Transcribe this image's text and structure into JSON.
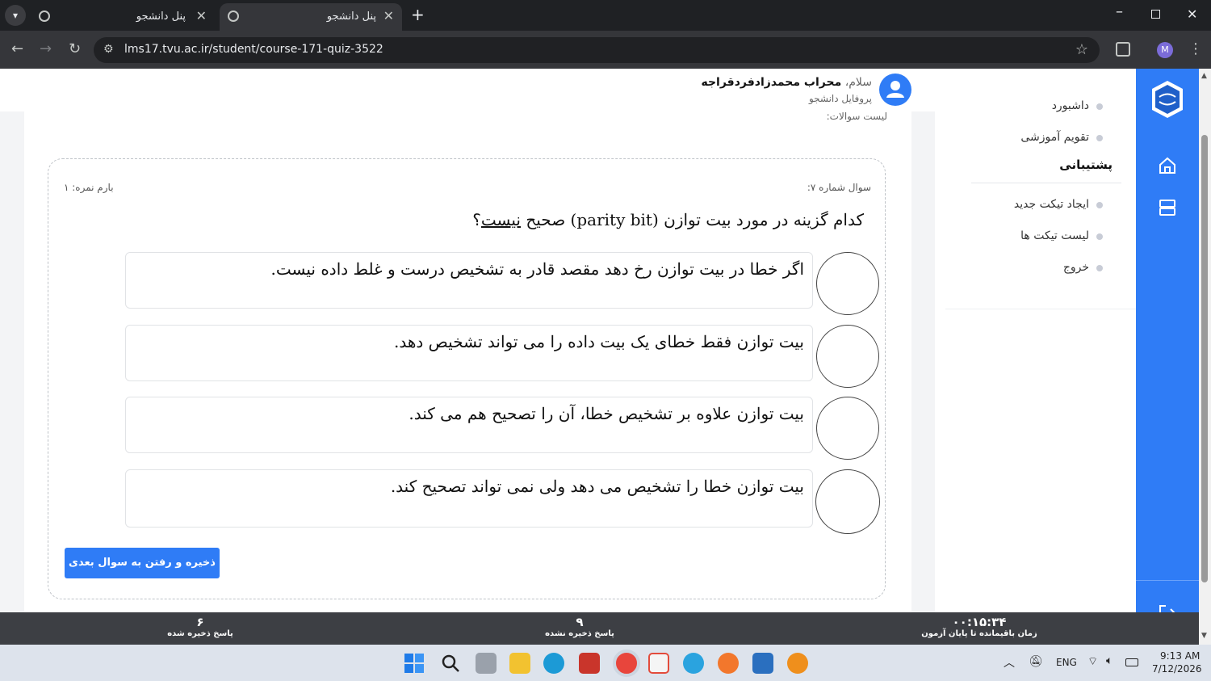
{
  "browser": {
    "tabs": [
      {
        "title": "پنل دانشجو",
        "active": false
      },
      {
        "title": "پنل دانشجو",
        "active": true
      }
    ],
    "url": "lms17.tvu.ac.ir/student/course-171-quiz-3522",
    "profile_initial": "M"
  },
  "header": {
    "greeting": "سلام،",
    "user_name": "محراب محمدزادفردقراجه",
    "profile_link": "پروفایل دانشجو"
  },
  "sidebar": {
    "items_top": [
      "داشبورد",
      "تقویم آموزشی"
    ],
    "section_title": "پشتیبانی",
    "items_support": [
      "ایجاد تیکت جدید",
      "لیست تیکت ها",
      "خروج"
    ]
  },
  "quiz": {
    "list_label": "لیست سوالات:",
    "question_number": "سوال شماره ۷:",
    "score": "بارم نمره: ۱",
    "question_text_before": "کدام گزینه در مورد بیت توازن (parity bit) صحیح ",
    "question_text_underlined": "نیست",
    "question_text_after": "؟",
    "options": [
      "اگر خطا در بیت توازن رخ دهد مقصد قادر به تشخیص درست و غلط داده نیست.",
      "بیت توازن فقط خطای یک بیت داده را می تواند تشخیص دهد.",
      "بیت توازن علاوه بر تشخیص خطا، آن را تصحیح هم می کند.",
      "بیت توازن خطا را تشخیص می دهد ولی نمی تواند تصحیح کند."
    ],
    "save_button": "ذخیره و رفتن به سوال بعدی"
  },
  "status": {
    "saved_count": "۶",
    "saved_label": "پاسخ ذخیره شده",
    "unsaved_count": "۹",
    "unsaved_label": "پاسخ ذخیره نشده",
    "time_left": "۰۰:۱۵:۳۴",
    "time_label": "زمان باقیمانده تا پایان آزمون"
  },
  "taskbar": {
    "lang": "ENG",
    "time": "9:13 AM",
    "date": "7/12/2026"
  },
  "colors": {
    "accent": "#2f7cf6",
    "statusbar": "#3d3f44"
  }
}
